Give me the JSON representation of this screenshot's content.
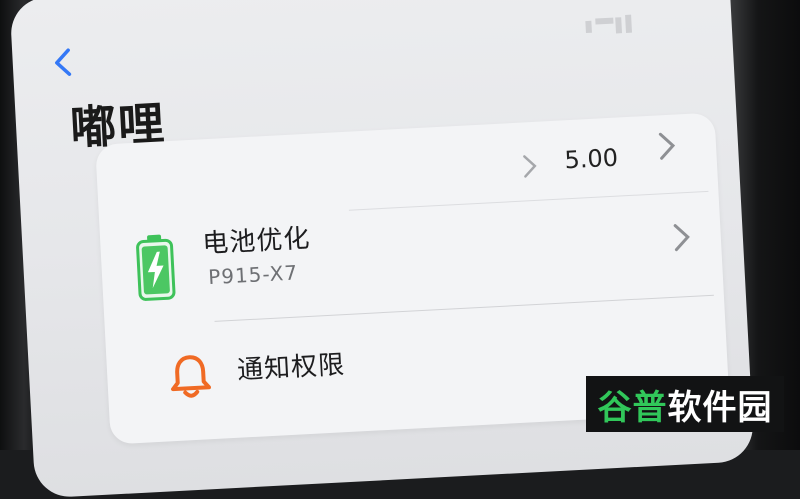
{
  "header": {
    "back_glyph": "<",
    "status_ghost": "ꟷ‗"
  },
  "page": {
    "title": "嘟哩"
  },
  "settings": {
    "top_row": {
      "chevron_small": ">",
      "value": "5.00",
      "chevron": ">"
    },
    "rows": [
      {
        "label": "电池优化",
        "subtitle": "P915-X7",
        "icon": "battery-charging-icon",
        "icon_color": "#3ec25a",
        "chevron": ">"
      },
      {
        "label": "通知权限",
        "icon": "bell-icon",
        "icon_color": "#f06a24"
      }
    ]
  },
  "watermark": {
    "part1": "谷普",
    "part2": "软件园"
  },
  "colors": {
    "accent": "#3478f6",
    "screen_bg": "#e8e9ec",
    "card_bg": "#f3f4f6"
  }
}
